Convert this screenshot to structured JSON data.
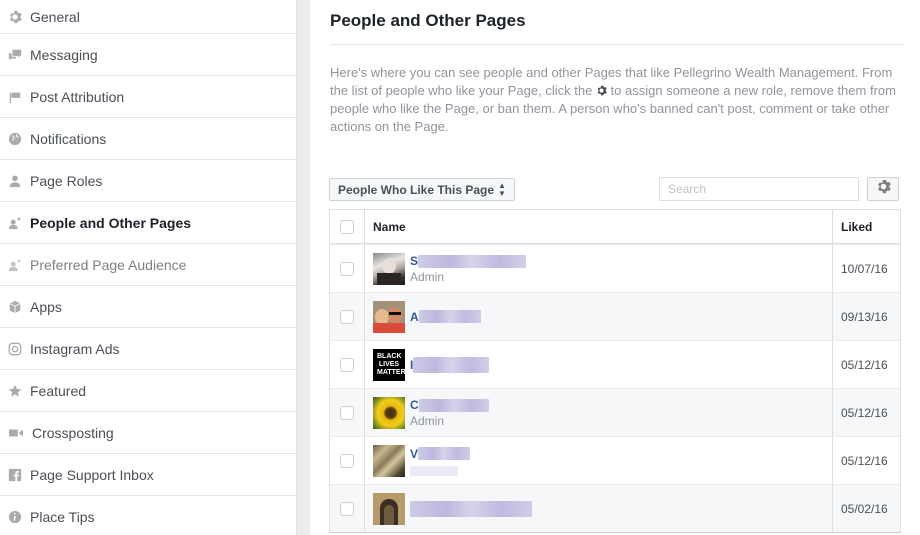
{
  "sidebar": {
    "items": [
      {
        "label": "General",
        "icon": "gear-icon"
      },
      {
        "label": "Messaging",
        "icon": "chat-bubbles-icon"
      },
      {
        "label": "Post Attribution",
        "icon": "flag-icon"
      },
      {
        "label": "Notifications",
        "icon": "globe-icon"
      },
      {
        "label": "Page Roles",
        "icon": "person-icon"
      },
      {
        "label": "People and Other Pages",
        "icon": "person-star-icon",
        "active": true
      },
      {
        "label": "Preferred Page Audience",
        "icon": "person-star-icon"
      },
      {
        "label": "Apps",
        "icon": "cube-icon"
      },
      {
        "label": "Instagram Ads",
        "icon": "instagram-icon"
      },
      {
        "label": "Featured",
        "icon": "star-icon"
      },
      {
        "label": "Crossposting",
        "icon": "video-camera-icon"
      },
      {
        "label": "Page Support Inbox",
        "icon": "facebook-icon"
      },
      {
        "label": "Place Tips",
        "icon": "info-icon"
      }
    ]
  },
  "main": {
    "title": "People and Other Pages",
    "description_part1": "Here's where you can see people and other Pages that like Pellegrino Wealth Management. From the list of people who like your Page, click the ",
    "description_part2": " to assign someone a new role, remove them from people who like the Page, or ban them. A person who's banned can't post, comment or take other actions on the Page.",
    "filter_label": "People Who Like This Page",
    "search_placeholder": "Search",
    "table": {
      "headers": {
        "name": "Name",
        "liked": "Liked"
      },
      "rows": [
        {
          "name_initial": "S",
          "name_redacted": true,
          "role": "Admin",
          "liked": "10/07/16",
          "avatar": "photo-person"
        },
        {
          "name_initial": "A",
          "name_redacted": true,
          "role": "",
          "liked": "09/13/16",
          "avatar": "photo-couple"
        },
        {
          "name_initial": "I",
          "name_redacted": true,
          "role": "",
          "liked": "05/12/16",
          "avatar": "black-lives-matter",
          "avatar_text": "BLACK LIVES MATTER"
        },
        {
          "name_initial": "C",
          "name_redacted": true,
          "role": "Admin",
          "liked": "05/12/16",
          "avatar": "photo-sunflower"
        },
        {
          "name_initial": "V",
          "name_redacted": true,
          "role": "",
          "liked": "05/12/16",
          "avatar": "photo-tree"
        },
        {
          "name_initial": "",
          "name_redacted": true,
          "role": "",
          "liked": "05/02/16",
          "avatar": "photo-doorway"
        }
      ]
    }
  }
}
